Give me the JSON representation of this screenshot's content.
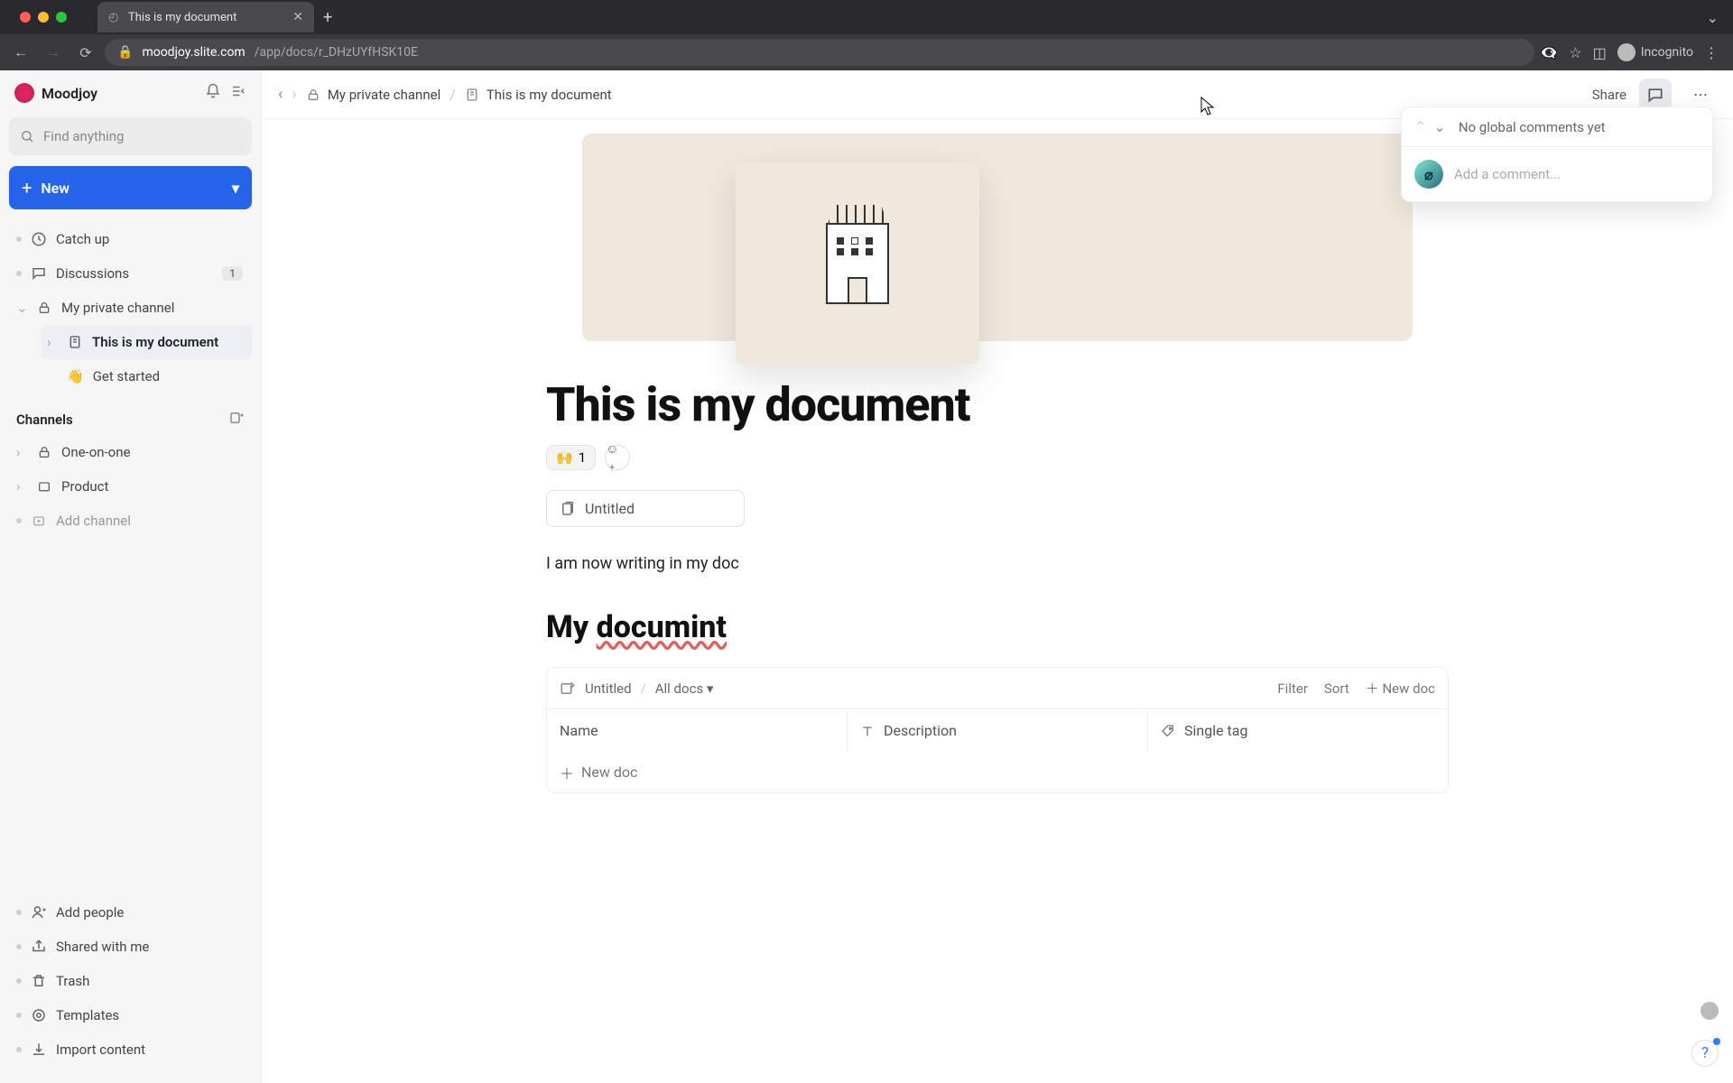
{
  "browser": {
    "tab_title": "This is my document",
    "url_host": "moodjoy.slite.com",
    "url_path": "/app/docs/r_DHzUYfHSK10E",
    "profile_label": "Incognito"
  },
  "workspace": {
    "name": "Moodjoy"
  },
  "sidebar": {
    "search_placeholder": "Find anything",
    "new_label": "New",
    "items": [
      {
        "label": "Catch up",
        "icon": "clock"
      },
      {
        "label": "Discussions",
        "icon": "chat",
        "badge": "1"
      },
      {
        "label": "My private channel",
        "icon": "lock"
      }
    ],
    "private_children": [
      {
        "label": "This is my document",
        "active": true,
        "icon": "doc"
      },
      {
        "label": "Get started",
        "emoji": "👋"
      }
    ],
    "channels_header": "Channels",
    "channels": [
      {
        "label": "One-on-one"
      },
      {
        "label": "Product"
      }
    ],
    "add_channel": "Add channel",
    "bottom": [
      {
        "label": "Add people",
        "icon": "user-plus"
      },
      {
        "label": "Shared with me",
        "icon": "share"
      },
      {
        "label": "Trash",
        "icon": "trash"
      },
      {
        "label": "Templates",
        "icon": "templates"
      },
      {
        "label": "Import content",
        "icon": "download"
      }
    ]
  },
  "breadcrumb": {
    "channel": "My private channel",
    "doc": "This is my document"
  },
  "topbar": {
    "share": "Share"
  },
  "document": {
    "title": "This is my document",
    "reaction_emoji": "🙌",
    "reaction_count": "1",
    "child_doc": "Untitled",
    "body": "I am now writing in my doc",
    "h2_prefix": "My ",
    "h2_typo": "documint"
  },
  "table": {
    "source": "Untitled",
    "scope": "All docs",
    "filter": "Filter",
    "sort": "Sort",
    "new_doc": "New doc",
    "columns": [
      "Name",
      "Description",
      "Single tag"
    ],
    "add_row": "New doc"
  },
  "comments": {
    "empty": "No global comments yet",
    "placeholder": "Add a comment..."
  }
}
